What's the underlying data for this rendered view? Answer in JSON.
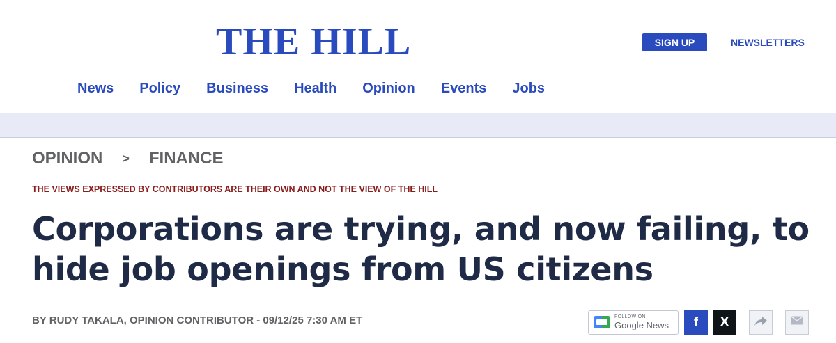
{
  "header": {
    "logo": "THE HILL",
    "signup_label": "SIGN UP",
    "newsletters_label": "NEWSLETTERS",
    "nav": [
      {
        "label": "News"
      },
      {
        "label": "Policy"
      },
      {
        "label": "Business"
      },
      {
        "label": "Health"
      },
      {
        "label": "Opinion"
      },
      {
        "label": "Events"
      },
      {
        "label": "Jobs"
      }
    ]
  },
  "breadcrumb": {
    "section": "OPINION",
    "separator": ">",
    "subsection": "FINANCE"
  },
  "article": {
    "disclaimer": "THE VIEWS EXPRESSED BY CONTRIBUTORS ARE THEIR OWN AND NOT THE VIEW OF THE HILL",
    "headline": "Corporations are trying, and now failing, to hide job openings from US citizens",
    "byline": "BY RUDY TAKALA, OPINION CONTRIBUTOR - 09/12/25 7:30 AM ET"
  },
  "share": {
    "google_news_follow": "FOLLOW ON",
    "google_news_label": "Google News",
    "facebook_glyph": "f",
    "x_glyph": "X",
    "share_icon": "share-arrow-icon",
    "email_icon": "envelope-icon"
  },
  "colors": {
    "brand_blue": "#2a4bbd",
    "headline": "#1f2b46",
    "disclaimer_red": "#8a1c1c",
    "band": "#e8eaf7"
  }
}
